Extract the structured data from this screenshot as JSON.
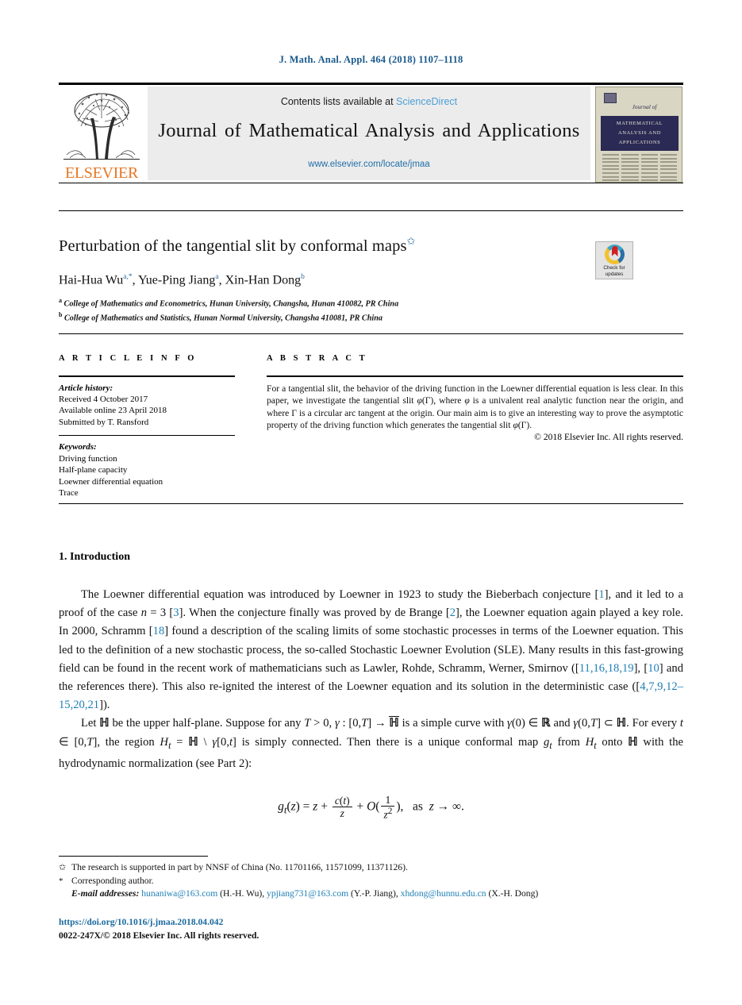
{
  "running_head": "J. Math. Anal. Appl. 464 (2018) 1107–1118",
  "masthead": {
    "contents_prefix": "Contents lists available at ",
    "sciencedirect": "ScienceDirect",
    "journal_title": "Journal of Mathematical Analysis and Applications",
    "journal_url": "www.elsevier.com/locate/jmaa",
    "publisher": "ELSEVIER",
    "cover": {
      "script": "Journal of",
      "band_line1": "MATHEMATICAL",
      "band_line2": "ANALYSIS AND",
      "band_line3": "APPLICATIONS"
    }
  },
  "article": {
    "title": "Perturbation of the tangential slit by conformal maps",
    "title_mark": "✩",
    "authors_html": "Hai-Hua Wu<sup>a,*</sup>, Yue-Ping Jiang<sup>a</sup>, Xin-Han Dong<sup>b</sup>",
    "affiliation_a": "College of Mathematics and Econometrics, Hunan University, Changsha, Hunan 410082, PR China",
    "affiliation_b": "College of Mathematics and Statistics, Hunan Normal University, Changsha 410081, PR China",
    "crossmark_label": "Check for updates"
  },
  "info": {
    "heading": "A R T I C L E    I N F O",
    "history_label": "Article history:",
    "history": [
      "Received 4 October 2017",
      "Available online 23 April 2018",
      "Submitted by T. Ransford"
    ],
    "keywords_label": "Keywords:",
    "keywords": [
      "Driving function",
      "Half-plane capacity",
      "Loewner differential equation",
      "Trace"
    ]
  },
  "abstract": {
    "heading": "A B S T R A C T",
    "copyright": "© 2018 Elsevier Inc. All rights reserved."
  },
  "body": {
    "section_heading": "1. Introduction"
  },
  "equation": {
    "lhs": "g",
    "lhs_sub": "t",
    "text": "g_t(z) = z + c(t)/z + O(1/z^2),  as z → ∞."
  },
  "footnotes": {
    "funding_mark": "✩",
    "funding": "The research is supported in part by NNSF of China (No. 11701166, 11571099, 11371126).",
    "corresponding_mark": "*",
    "corresponding": "Corresponding author.",
    "email_label": "E-mail addresses:",
    "emails": [
      {
        "address": "hunaniwa@163.com",
        "author": "(H.-H. Wu)"
      },
      {
        "address": "ypjiang731@163.com",
        "author": "(Y.-P. Jiang)"
      },
      {
        "address": "xhdong@hunnu.edu.cn",
        "author": "(X.-H. Dong)"
      }
    ],
    "doi": "https://doi.org/10.1016/j.jmaa.2018.04.042",
    "issn": "0022-247X/© 2018 Elsevier Inc. All rights reserved."
  },
  "colors": {
    "link_blue": "#1f7fb5",
    "header_blue": "#1a5a8e",
    "elsevier_orange": "#E87722",
    "cover_navy": "#2b2a54"
  }
}
